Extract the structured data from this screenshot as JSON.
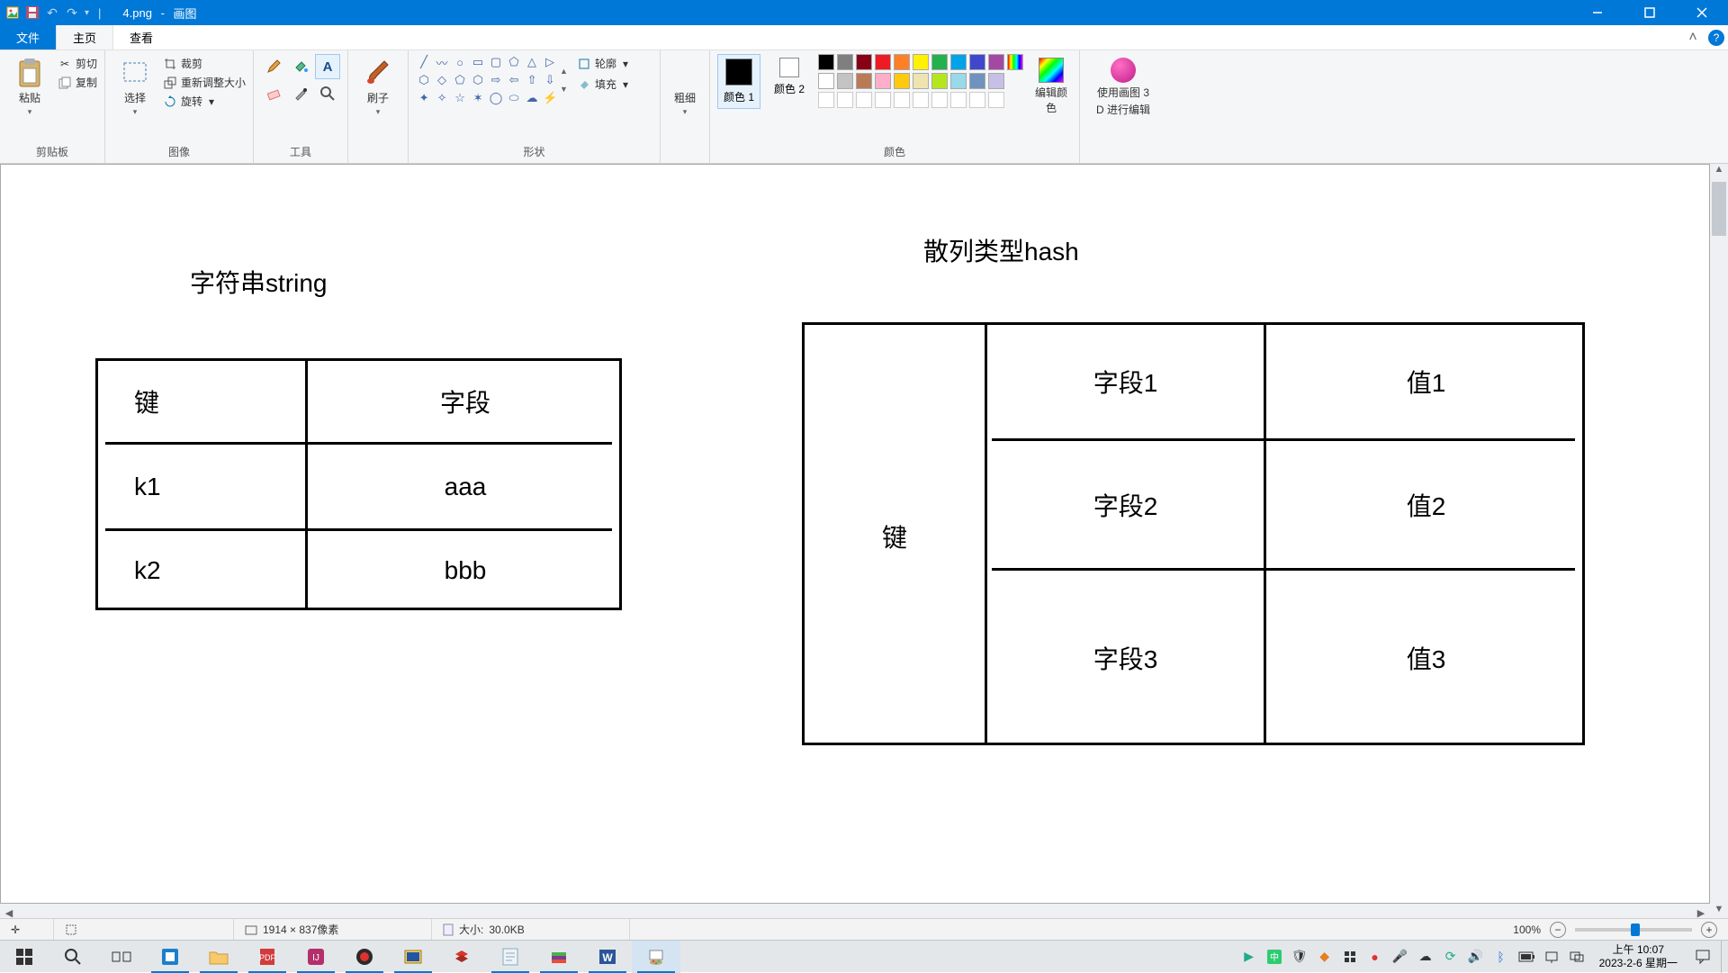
{
  "titlebar": {
    "filename": "4.png",
    "app": "画图"
  },
  "qat": {
    "undo": "↶",
    "redo": "↷"
  },
  "tabs": {
    "file": "文件",
    "home": "主页",
    "view": "查看"
  },
  "ribbon": {
    "clipboard": {
      "paste": "粘贴",
      "cut": "剪切",
      "copy": "复制",
      "label": "剪贴板"
    },
    "image": {
      "select": "选择",
      "crop": "裁剪",
      "resize": "重新调整大小",
      "rotate": "旋转",
      "label": "图像"
    },
    "tools": {
      "label": "工具"
    },
    "brush": {
      "label": "刷子"
    },
    "shapes": {
      "outline": "轮廓",
      "fill": "填充",
      "label": "形状"
    },
    "thickness": {
      "label": "粗细"
    },
    "colors": {
      "c1": "颜色 1",
      "c2": "颜色 2",
      "edit": "编辑颜色",
      "label": "颜色"
    },
    "paint3d": {
      "line1": "使用画图 3",
      "line2": "D 进行编辑"
    }
  },
  "palette_row1": [
    "#000000",
    "#7f7f7f",
    "#880015",
    "#ed1c24",
    "#ff7f27",
    "#fff200",
    "#22b14c",
    "#00a2e8",
    "#3f48cc",
    "#a349a4"
  ],
  "palette_row2": [
    "#ffffff",
    "#c3c3c3",
    "#b97a57",
    "#ffaec9",
    "#ffc90e",
    "#efe4b0",
    "#b5e61d",
    "#99d9ea",
    "#7092be",
    "#c8bfe7"
  ],
  "canvas": {
    "title_left": "字符串string",
    "title_right": "散列类型hash",
    "left_table": {
      "r1c1": "键",
      "r1c2": "字段",
      "r2c1": "k1",
      "r2c2": "aaa",
      "r3c1": "k2",
      "r3c2": "bbb"
    },
    "right_table": {
      "key": "键",
      "f1": "字段1",
      "v1": "值1",
      "f2": "字段2",
      "v2": "值2",
      "f3": "字段3",
      "v3": "值3"
    }
  },
  "status": {
    "dims": "1914 × 837像素",
    "size_label": "大小:",
    "size_val": "30.0KB",
    "zoom": "100%"
  },
  "tray": {
    "time": "上午 10:07",
    "date": "2023-2-6 星期一"
  }
}
